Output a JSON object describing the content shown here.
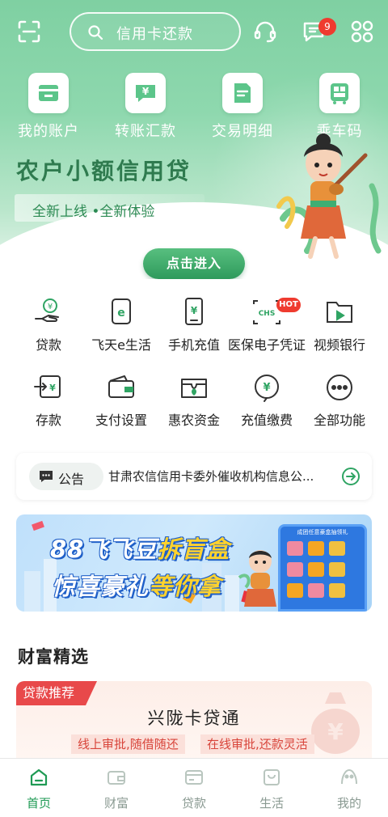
{
  "header": {
    "search_placeholder": "信用卡还款",
    "message_badge": "9"
  },
  "quick_actions": [
    {
      "label": "我的账户",
      "icon": "account-card-icon"
    },
    {
      "label": "转账汇款",
      "icon": "transfer-yuan-icon"
    },
    {
      "label": "交易明细",
      "icon": "transaction-list-icon"
    },
    {
      "label": "乘车码",
      "icon": "bus-qr-icon"
    }
  ],
  "promo": {
    "title": "农户小额信用贷",
    "subtitle": "全新上线 •全新体验",
    "button": "点击进入"
  },
  "menu_row1": [
    {
      "label": "贷款",
      "icon": "loan-hand-icon"
    },
    {
      "label": "飞天e生活",
      "icon": "e-life-icon"
    },
    {
      "label": "手机充值",
      "icon": "phone-topup-icon"
    },
    {
      "label": "医保电子凭证",
      "icon": "medical-insurance-icon",
      "badge": "HOT"
    },
    {
      "label": "视频银行",
      "icon": "video-bank-icon"
    }
  ],
  "menu_row2": [
    {
      "label": "存款",
      "icon": "deposit-icon"
    },
    {
      "label": "支付设置",
      "icon": "wallet-icon"
    },
    {
      "label": "惠农资金",
      "icon": "farm-fund-icon"
    },
    {
      "label": "充值缴费",
      "icon": "bill-pay-icon"
    },
    {
      "label": "全部功能",
      "icon": "more-dots-icon"
    }
  ],
  "notice": {
    "tag": "公告",
    "text": "甘肃农信信用卡委外催收机构信息公..."
  },
  "banner": {
    "line1_prefix": "88飞飞豆",
    "line1_highlight": "拆盲盒",
    "line2_prefix": "惊喜豪礼",
    "line2_highlight": "等你拿",
    "machine_title": "成团任意豪盒抽领礼"
  },
  "wealth": {
    "title": "财富精选",
    "card_tag": "贷款推荐",
    "card_name": "兴陇卡贷通",
    "pill_left": "线上审批,随借随还",
    "pill_right": "在线审批,还款灵活"
  },
  "tabbar": [
    {
      "label": "首页",
      "icon": "home-icon",
      "active": true
    },
    {
      "label": "财富",
      "icon": "wealth-wallet-icon",
      "active": false
    },
    {
      "label": "贷款",
      "icon": "loan-card-icon",
      "active": false
    },
    {
      "label": "生活",
      "icon": "life-bag-icon",
      "active": false
    },
    {
      "label": "我的",
      "icon": "profile-icon",
      "active": false
    }
  ],
  "colors": {
    "brand_green": "#1f9a54",
    "hero_green": "#7fd0a2",
    "badge_red": "#ef3b2f",
    "tag_red": "#e8494a"
  }
}
